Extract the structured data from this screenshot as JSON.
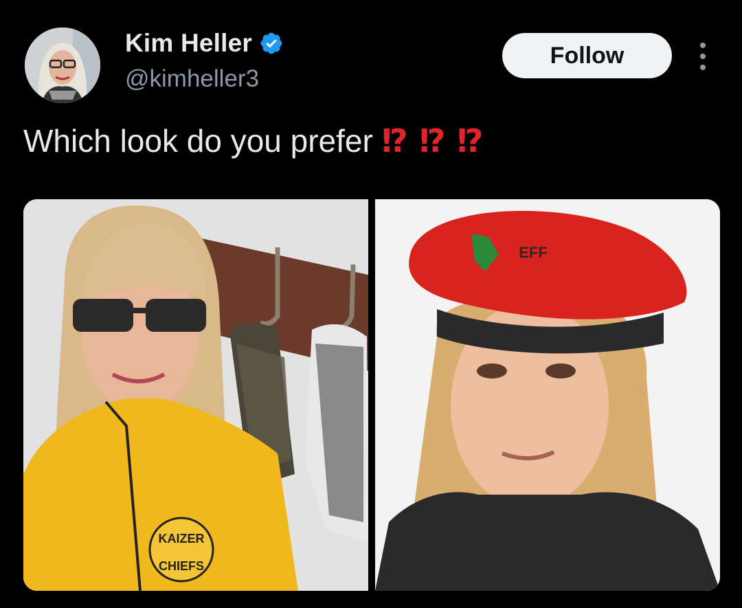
{
  "tweet": {
    "author": {
      "name": "Kim Heller",
      "handle": "@kimheller3",
      "verified": true,
      "avatar_icon": "avatar-photo"
    },
    "follow_label": "Follow",
    "more_icon": "more-vertical-icon",
    "text": "Which look do you prefer",
    "emoji_text": "⁉ ⁉ ⁉",
    "media": [
      {
        "description_icon": "photo-yellow-jacket"
      },
      {
        "description_icon": "photo-red-beret"
      }
    ]
  },
  "colors": {
    "background": "#000000",
    "text": "#e7e9ea",
    "secondary": "#8b98a5",
    "verified": "#1d9bf0",
    "follow_bg": "#eff3f4",
    "emoji_red": "#e0242b"
  }
}
